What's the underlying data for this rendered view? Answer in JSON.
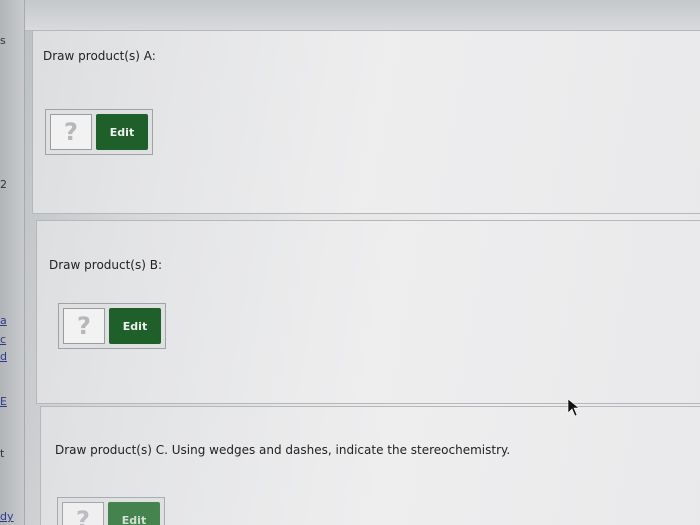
{
  "left_rail": {
    "glyphs": [
      {
        "text": "s",
        "style": "dark"
      },
      {
        "text": "2",
        "style": "dark"
      },
      {
        "text": "a",
        "style": "link"
      },
      {
        "text": "c",
        "style": "link"
      },
      {
        "text": "d",
        "style": "link"
      },
      {
        "text": "E",
        "style": "link"
      },
      {
        "text": "t",
        "style": "dark"
      },
      {
        "text": "dy",
        "style": "link"
      }
    ]
  },
  "questions": [
    {
      "prompt": "Draw product(s) A:",
      "placeholder_glyph": "?",
      "edit_label": "Edit"
    },
    {
      "prompt": "Draw product(s) B:",
      "placeholder_glyph": "?",
      "edit_label": "Edit"
    },
    {
      "prompt": "Draw product(s) C. Using wedges and dashes, indicate the stereochemistry.",
      "placeholder_glyph": "?",
      "edit_label": "Edit"
    }
  ],
  "colors": {
    "edit_button": "#1f5f2a",
    "link": "#2c3b8a"
  }
}
